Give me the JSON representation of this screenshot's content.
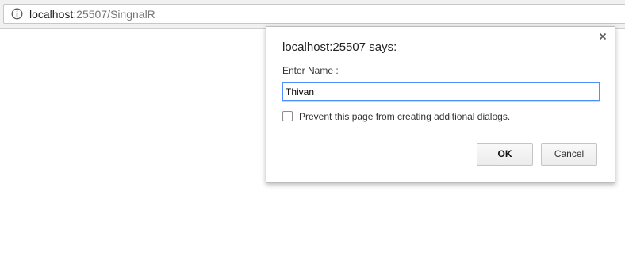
{
  "browser": {
    "url_host": "localhost",
    "url_rest": ":25507/SingnalR",
    "site_info_icon": "info-circle-icon"
  },
  "dialog": {
    "title": "localhost:25507 says:",
    "prompt_label": "Enter Name :",
    "input_value": "Thivan",
    "checkbox_label": "Prevent this page from creating additional dialogs.",
    "checkbox_checked": false,
    "ok_label": "OK",
    "cancel_label": "Cancel",
    "close_icon": "close-icon"
  }
}
